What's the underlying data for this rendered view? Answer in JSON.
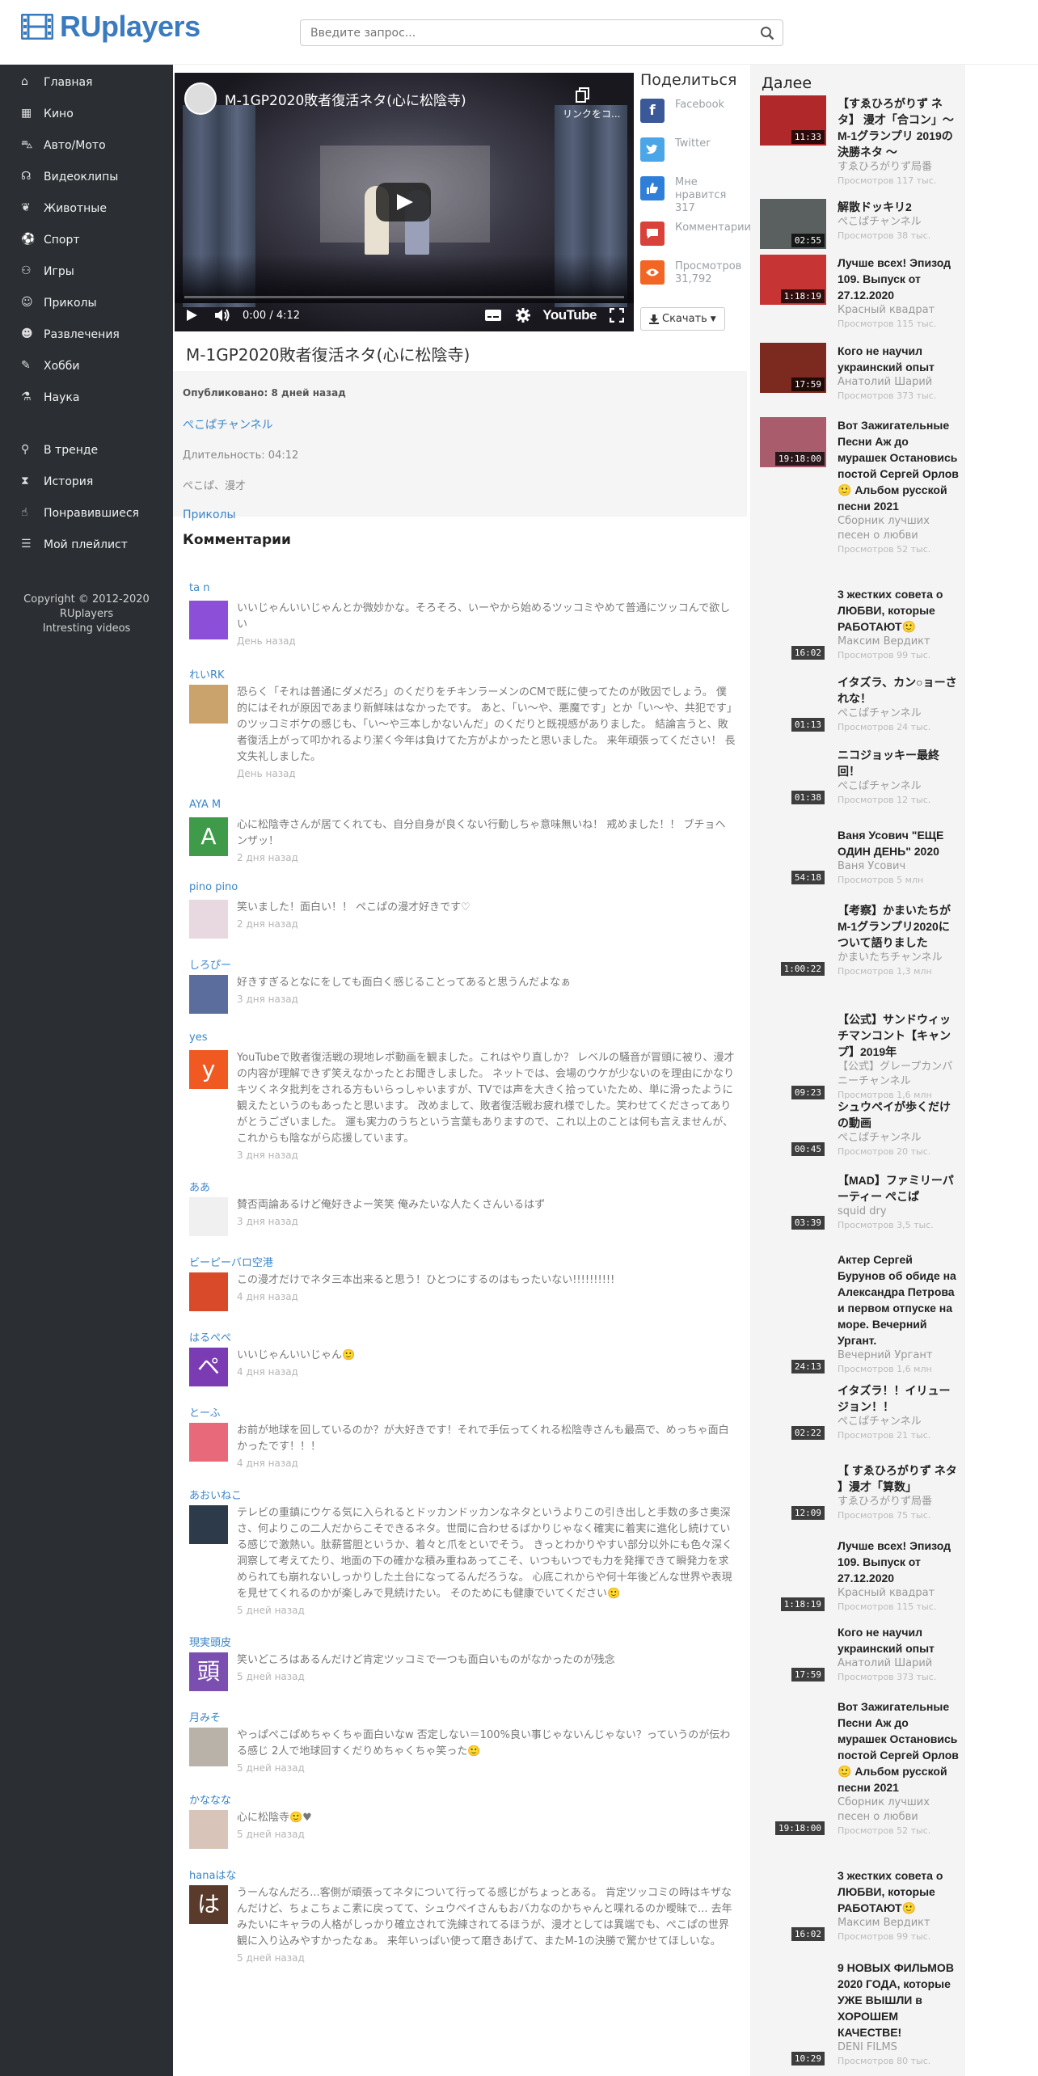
{
  "header": {
    "logo": "RUplayers",
    "search_placeholder": "Введите запрос..."
  },
  "sidebar": {
    "items": [
      {
        "label": "Главная",
        "icon": "home-icon"
      },
      {
        "label": "Кино",
        "icon": "film-icon"
      },
      {
        "label": "Авто/Мото",
        "icon": "car-icon"
      },
      {
        "label": "Видеоклипы",
        "icon": "headphones-icon"
      },
      {
        "label": "Животные",
        "icon": "paw-icon"
      },
      {
        "label": "Спорт",
        "icon": "ball-icon"
      },
      {
        "label": "Игры",
        "icon": "gamepad-icon"
      },
      {
        "label": "Приколы",
        "icon": "smile-icon"
      },
      {
        "label": "Развлечения",
        "icon": "theater-icon"
      },
      {
        "label": "Хобби",
        "icon": "wrench-icon"
      },
      {
        "label": "Наука",
        "icon": "flask-icon"
      }
    ],
    "items2": [
      {
        "label": "В тренде",
        "icon": "pin-icon"
      },
      {
        "label": "История",
        "icon": "hourglass-icon"
      },
      {
        "label": "Понравившиеся",
        "icon": "thumbs-up-icon"
      },
      {
        "label": "Мой плейлист",
        "icon": "list-icon"
      }
    ],
    "copyright": [
      "Copyright © 2012-2020",
      "RUplayers",
      "Intresting videos"
    ]
  },
  "player": {
    "title": "M-1GP2020敗者復活ネタ(心に松陰寺)",
    "copy_text": "リンクをコ...",
    "time": "0:00 / 4:12",
    "brand": "YouTube"
  },
  "share": {
    "title": "Поделиться",
    "facebook": "Facebook",
    "twitter": "Twitter",
    "likes": "Мне нравится 317",
    "comments": "Комментарии",
    "views": "Просмотров 31,792",
    "download": "Скачать"
  },
  "video": {
    "title": "M-1GP2020敗者復活ネタ(心に松陰寺)",
    "published": "Опубликовано: 8 дней назад",
    "channel": "ぺこぱチャンネル",
    "duration": "Длительность: 04:12",
    "tags": "ぺこぱ、漫才",
    "category": "Приколы"
  },
  "comments_title": "Комментарии",
  "comments": [
    {
      "author": "ta n",
      "text": "いいじゃんいいじゃんとか微妙かな。そろそろ、いーやから始めるツッコミやめて普通にツッコんで欲しい",
      "date": "День назад",
      "color": "#8b4fd8",
      "letter": ""
    },
    {
      "author": "れいRK",
      "text": "恐らく「それは普通にダメだろ」のくだりをチキンラーメンのCMで既に使ってたのが敗因でしょう。 僕的にはそれが原因であまり新鮮味はなかったです。 あと、「い〜や、悪魔です」とか「い〜や、共犯です」のツッコミボケの感じも、「い〜や三本しかないんだ」のくだりと既視感がありました。 結論言うと、敗者復活上がって叩かれるより潔く今年は負けてた方がよかったと思いました。 来年頑張ってください！ 長文失礼しました。",
      "date": "День назад",
      "color": "#c9a26c",
      "letter": ""
    },
    {
      "author": "AYA M",
      "text": "心に松陰寺さんが居てくれても、自分自身が良くない行動しちゃ意味無いね！ 戒めました！！ ブチョヘンザッ！",
      "date": "2 дня назад",
      "color": "#3f9b4a",
      "letter": "A"
    },
    {
      "author": "pino pino",
      "text": "笑いました！面白い！！ ぺこぱの漫才好きです♡",
      "date": "2 дня назад",
      "color": "#e8d8e0",
      "letter": ""
    },
    {
      "author": "しろぴー",
      "text": "好きすぎるとなにをしても面白く感じることってあると思うんだよなぁ",
      "date": "3 дня назад",
      "color": "#5a6d9c",
      "letter": ""
    },
    {
      "author": "yes",
      "text": "YouTubeで敗者復活戦の現地レポ動画を観ました。これはやり直しか？ レベルの騒音が冒頭に被り、漫才の内容が理解できず笑えなかったとお聞きしました。 ネットでは、会場のウケが少ないのを理由にかなりキツくネタ批判をされる方もいらっしゃいますが、TVでは声を大きく拾っていたため、単に滑ったように観えたというのもあったと思います。 改めまして、敗者復活戦お疲れ様でした。笑わせてくださってありがとうございました。 運も実力のうちという言葉もありますので、これ以上のことは何も言えませんが、これからも陰ながら応援しています。",
      "date": "3 дня назад",
      "color": "#f05a22",
      "letter": "y"
    },
    {
      "author": "ああ",
      "text": "賛否両論あるけど俺好きよー笑笑 俺みたいな人たくさんいるはず",
      "date": "3 дня назад",
      "color": "#f0f0f0",
      "letter": ""
    },
    {
      "author": "ビーピーバロ空港",
      "text": "この漫才だけでネタ三本出来ると思う！ひとつにするのはもったいない!!!!!!!!!!",
      "date": "4 дня назад",
      "color": "#d84a2a",
      "letter": ""
    },
    {
      "author": "はるぺぺ",
      "text": "いいじゃんいいじゃん🙂",
      "date": "4 дня назад",
      "color": "#7a3bb3",
      "letter": "ペペ"
    },
    {
      "author": "とーふ",
      "text": "お前が地球を回しているのか？が大好きです！それで手伝ってくれる松陰寺さんも最高で、めっちゃ面白かったです！！！",
      "date": "4 дня назад",
      "color": "#e86a7a",
      "letter": ""
    },
    {
      "author": "あおいねこ",
      "text": "テレビの重鎮にウケる気に入られるとドッカンドッカンなネタというよりこの引き出しと手数の多さ奥深さ、何よりこの二人だからこそできるネタ。世間に合わせるばかりじゃなく確実に着実に進化し続けている感じで激熱い。肽薪嘗胆というか、着々と爪をといでそう。 きっとわかりやすい部分以外にも色々深く洞察して考えてたり、地面の下の確かな積み重ねあってこそ、いつもいつでも力を発揮できて瞬発力を求められても崩れないしっかりした土台になってるんだろうな。 心底これからや何十年後どんな世界や表現を見せてくれるのかが楽しみで見続けたい。 そのためにも健康でいてください🙂",
      "date": "5 дней назад",
      "color": "#2c3a4a",
      "letter": ""
    },
    {
      "author": "現実頭皮",
      "text": "笑いどころはあるんだけど肯定ツッコミで一つも面白いものがなかったのが残念",
      "date": "5 дней назад",
      "color": "#7b4fb0",
      "letter": "頭皮"
    },
    {
      "author": "月みそ",
      "text": "やっぱぺこぱめちゃくちゃ面白いなw 否定しない＝100%良い事じゃないんじゃない？っていうのが伝わる感じ 2人で地球回すくだりめちゃくちゃ笑った🙂",
      "date": "5 дней назад",
      "color": "#b8b2a8",
      "letter": ""
    },
    {
      "author": "かななな",
      "text": "心に松陰寺🙂♥",
      "date": "5 дней назад",
      "color": "#d8c4b8",
      "letter": ""
    },
    {
      "author": "hanaはな",
      "text": "うーんなんだろ...客側が頑張ってネタについて行ってる感じがちょっとある。 肯定ツッコミの時はキザなんだけど、ちょこちょこ素に戻ってて、シュウペイさんもおバカなのかちゃんと喋れるのか曖昧で... 去年みたいにキャラの人格がしっかり確立されて洗練されてるほうが、漫才としては異端でも、ぺこぱの世界観に入り込みやすかったなぁ。 来年いっぱい使って磨きあげて、またM-1の決勝で驚かせてほしいな。",
      "date": "5 дней назад",
      "color": "#5a3a2a",
      "letter": "はな"
    }
  ],
  "right": {
    "title": "Далее",
    "items": [
      {
        "title": "【すゑひろがりず ネタ】 漫才「合コン」〜 M-1グランプリ 2019の 決勝ネタ 〜",
        "channel": "すゑひろがりず局番",
        "views": "Просмотров 117 тыс.",
        "duration": "11:33",
        "color": "#b0282a"
      },
      {
        "title": "解散ドッキリ2",
        "channel": "ぺこぱチャンネル",
        "views": "Просмотров 38 тыс.",
        "duration": "02:55",
        "color": "#5a6060"
      },
      {
        "title": "Лучше всех! Эпизод 109. Выпуск от 27.12.2020",
        "channel": "Красный квадрат",
        "views": "Просмотров 115 тыс.",
        "duration": "1:18:19",
        "color": "#c63434"
      },
      {
        "title": "Кого не научил украинский опыт",
        "channel": "Анатолий Шарий",
        "views": "Просмотров 373 тыс.",
        "duration": "17:59",
        "color": "#7c2a20"
      },
      {
        "title": "Вот Зажигательные Песни Аж до мурашек Остановись постой Сергей Орлов 🙂 Альбом русской песни 2021",
        "channel": "Сборник лучших песен о любви",
        "views": "Просмотров 52 тыс.",
        "duration": "19:18:00",
        "color": "#a85c6c"
      },
      {
        "title": "3 жестких совета о ЛЮБВИ, которые РАБОТАЮТ🙂",
        "channel": "Максим Вердикт",
        "views": "Просмотров 99 тыс.",
        "duration": "16:02",
        "color": "#f4f4f4"
      },
      {
        "title": "イタズラ、カン○ョーされな！",
        "channel": "ぺこぱチャンネル",
        "views": "Просмотров 24 тыс.",
        "duration": "01:13",
        "color": "#f4f4f4"
      },
      {
        "title": "ニコジョッキー最終回！",
        "channel": "ぺこぱチャンネル",
        "views": "Просмотров 12 тыс.",
        "duration": "01:38",
        "color": "#f4f4f4"
      },
      {
        "title": "Ваня Усович \"ЕЩЕ ОДИН ДЕНЬ\" 2020",
        "channel": "Ваня Усович",
        "views": "Просмотров 5 млн",
        "duration": "54:18",
        "color": "#f4f4f4"
      },
      {
        "title": "【考察】かまいたちがM-1グランプリ2020について語りました",
        "channel": "かまいたちチャンネル",
        "views": "Просмотров 1,3 млн",
        "duration": "1:00:22",
        "color": "#f4f4f4"
      },
      {
        "title": "【公式】サンドウィッチマンコント【キャンプ】2019年",
        "channel": "【公式】グレープカンパニーチャンネル",
        "views": "Просмотров 1,6 млн",
        "duration": "09:23",
        "color": "#f4f4f4"
      },
      {
        "title": "シュウペイが歩くだけの動画",
        "channel": "ぺこぱチャンネル",
        "views": "Просмотров 20 тыс.",
        "duration": "00:45",
        "color": "#f4f4f4"
      },
      {
        "title": "【MAD】ファミリーパーティー ぺこぱ",
        "channel": "squid dry",
        "views": "Просмотров 3,5 тыс.",
        "duration": "03:39",
        "color": "#f4f4f4"
      },
      {
        "title": "Актер Сергей Бурунов об обиде на Александра Петрова и первом отпуске на море. Вечерний Ургант.",
        "channel": "Вечерний Ургант",
        "views": "Просмотров 1,6 млн",
        "duration": "24:13",
        "color": "#f4f4f4"
      },
      {
        "title": "イタズラ！！イリュージョン！！",
        "channel": "ぺこぱチャンネル",
        "views": "Просмотров 21 тыс.",
        "duration": "02:22",
        "color": "#f4f4f4"
      },
      {
        "title": "【 すゑひろがりず ネタ 】漫才「算数」",
        "channel": "すゑひろがりず局番",
        "views": "Просмотров 75 тыс.",
        "duration": "12:09",
        "color": "#f4f4f4"
      },
      {
        "title": "Лучше всех! Эпизод 109. Выпуск от 27.12.2020",
        "channel": "Красный квадрат",
        "views": "Просмотров 115 тыс.",
        "duration": "1:18:19",
        "color": "#f4f4f4"
      },
      {
        "title": "Кого не научил украинский опыт",
        "channel": "Анатолий Шарий",
        "views": "Просмотров 373 тыс.",
        "duration": "17:59",
        "color": "#f4f4f4"
      },
      {
        "title": "Вот Зажигательные Песни Аж до мурашек Остановись постой Сергей Орлов 🙂 Альбом русской песни 2021",
        "channel": "Сборник лучших песен о любви",
        "views": "Просмотров 52 тыс.",
        "duration": "19:18:00",
        "color": "#f4f4f4"
      },
      {
        "title": "3 жестких совета о ЛЮБВИ, которые РАБОТАЮТ🙂",
        "channel": "Максим Вердикт",
        "views": "Просмотров 99 тыс.",
        "duration": "16:02",
        "color": "#f4f4f4"
      },
      {
        "title": "9 НОВЫХ ФИЛЬМОВ 2020 ГОДА, которые УЖЕ ВЫШЛИ в ХОРОШЕМ КАЧЕСТВЕ!",
        "channel": "DENI FILMS",
        "views": "Просмотров 80 тыс.",
        "duration": "10:29",
        "color": "#f4f4f4"
      }
    ]
  }
}
